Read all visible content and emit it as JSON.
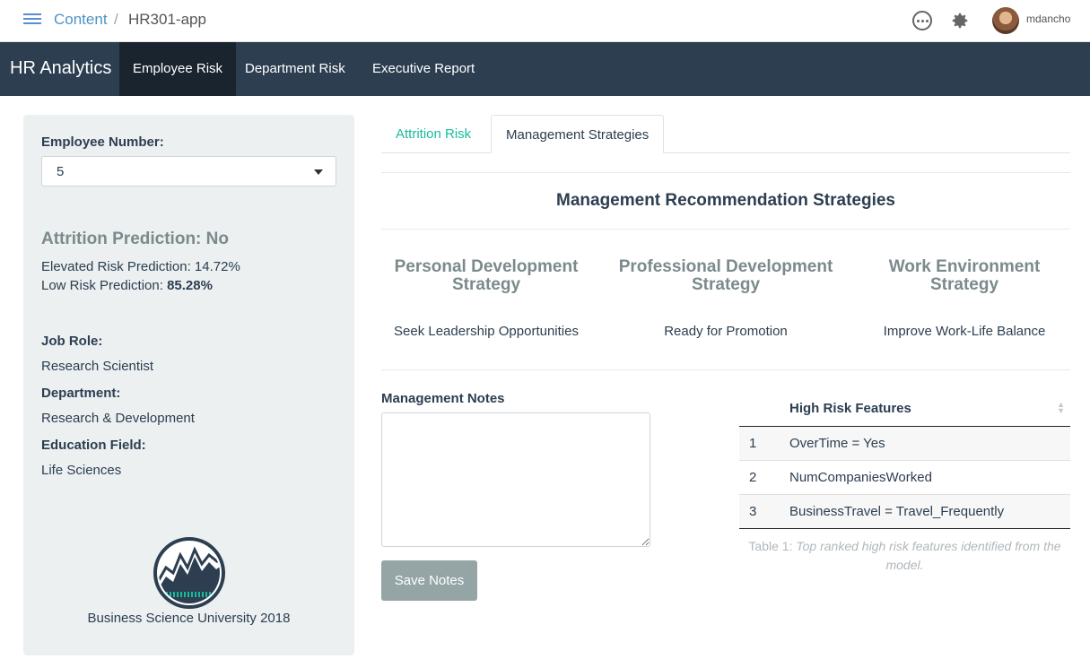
{
  "topbar": {
    "breadcrumb_content": "Content",
    "breadcrumb_separator": "/",
    "breadcrumb_app": "HR301-app",
    "username": "mdancho",
    "icons": [
      "menu-icon",
      "more-icon",
      "gear-icon",
      "avatar"
    ]
  },
  "navbar": {
    "brand": "HR Analytics",
    "tabs": [
      {
        "label": "Employee Risk",
        "active": true
      },
      {
        "label": "Department Risk",
        "active": false
      },
      {
        "label": "Executive Report",
        "active": false
      }
    ]
  },
  "sidebar": {
    "employee_label": "Employee Number:",
    "employee_value": "5",
    "prediction_title": "Attrition Prediction: No",
    "elevated_label": "Elevated Risk Prediction: ",
    "elevated_value": "14.72%",
    "low_label": "Low Risk Prediction: ",
    "low_value": "85.28%",
    "job_role_label": "Job Role:",
    "job_role_value": "Research Scientist",
    "department_label": "Department:",
    "department_value": "Research & Development",
    "education_label": "Education Field:",
    "education_value": "Life Sciences",
    "logo_caption": "Business Science University 2018"
  },
  "main": {
    "tabs": [
      {
        "label": "Attrition Risk",
        "active": false
      },
      {
        "label": "Management Strategies",
        "active": true
      }
    ],
    "section_title": "Management Recommendation Strategies",
    "strategies": [
      {
        "title_line1": "Personal Development",
        "title_line2": "Strategy",
        "value": "Seek Leadership Opportunities"
      },
      {
        "title_line1": "Professional Development",
        "title_line2": "Strategy",
        "value": "Ready for Promotion"
      },
      {
        "title_line1": "Work Environment",
        "title_line2": "Strategy",
        "value": "Improve Work-Life Balance"
      }
    ],
    "notes_label": "Management Notes",
    "notes_value": "",
    "save_label": "Save Notes",
    "table": {
      "header": "High Risk Features",
      "rows": [
        {
          "num": "1",
          "feature": "OverTime = Yes"
        },
        {
          "num": "2",
          "feature": "NumCompaniesWorked"
        },
        {
          "num": "3",
          "feature": "BusinessTravel = Travel_Frequently"
        }
      ],
      "caption_prefix": "Table 1: ",
      "caption_text": "Top ranked high risk features identified from the model."
    }
  },
  "colors": {
    "navbar_bg": "#2c3e50",
    "navbar_active": "#1a242f",
    "accent_teal": "#18bc9c",
    "sidebar_bg": "#ecf0f1",
    "muted": "#7b8a8b",
    "button_bg": "#95a5a6"
  }
}
